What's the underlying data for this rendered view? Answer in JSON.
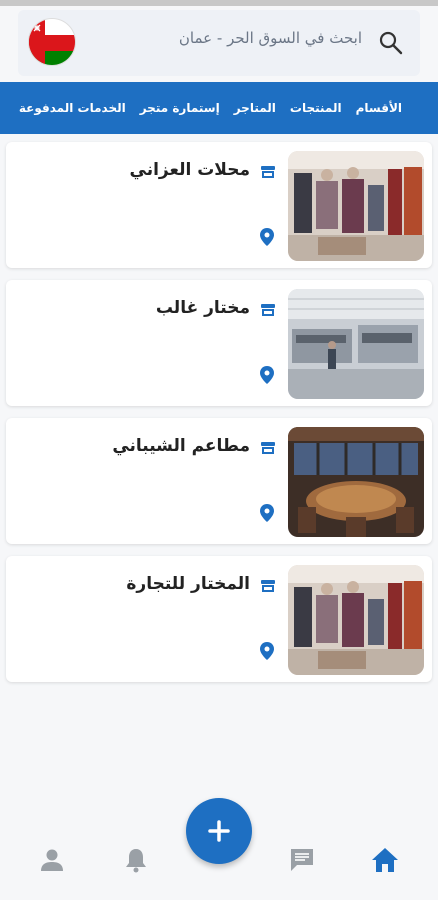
{
  "search": {
    "placeholder": "ابحث في السوق الحر - عمان",
    "icon": "search-icon"
  },
  "flag": {
    "icon": "oman-flag-icon"
  },
  "nav": {
    "items": [
      "الأقسام",
      "المنتجات",
      "المتاجر",
      "إستمارة متجر",
      "الخدمات المدفوعة"
    ]
  },
  "stores": [
    {
      "title": "محلات العزاني",
      "image": "clothing-store-photo"
    },
    {
      "title": "مختار غالب",
      "image": "factory-photo"
    },
    {
      "title": "مطاعم الشيباني",
      "image": "restaurant-photo"
    },
    {
      "title": "المختار للتجارة",
      "image": "clothing-store-photo"
    }
  ],
  "bottom_nav": {
    "items": [
      "home-icon",
      "chat-icon",
      "add-icon",
      "notifications-icon",
      "profile-icon"
    ]
  },
  "colors": {
    "primary": "#1e6fc2",
    "card_icon": "#1e6fc2",
    "inactive_icon": "#9aa0a6"
  }
}
